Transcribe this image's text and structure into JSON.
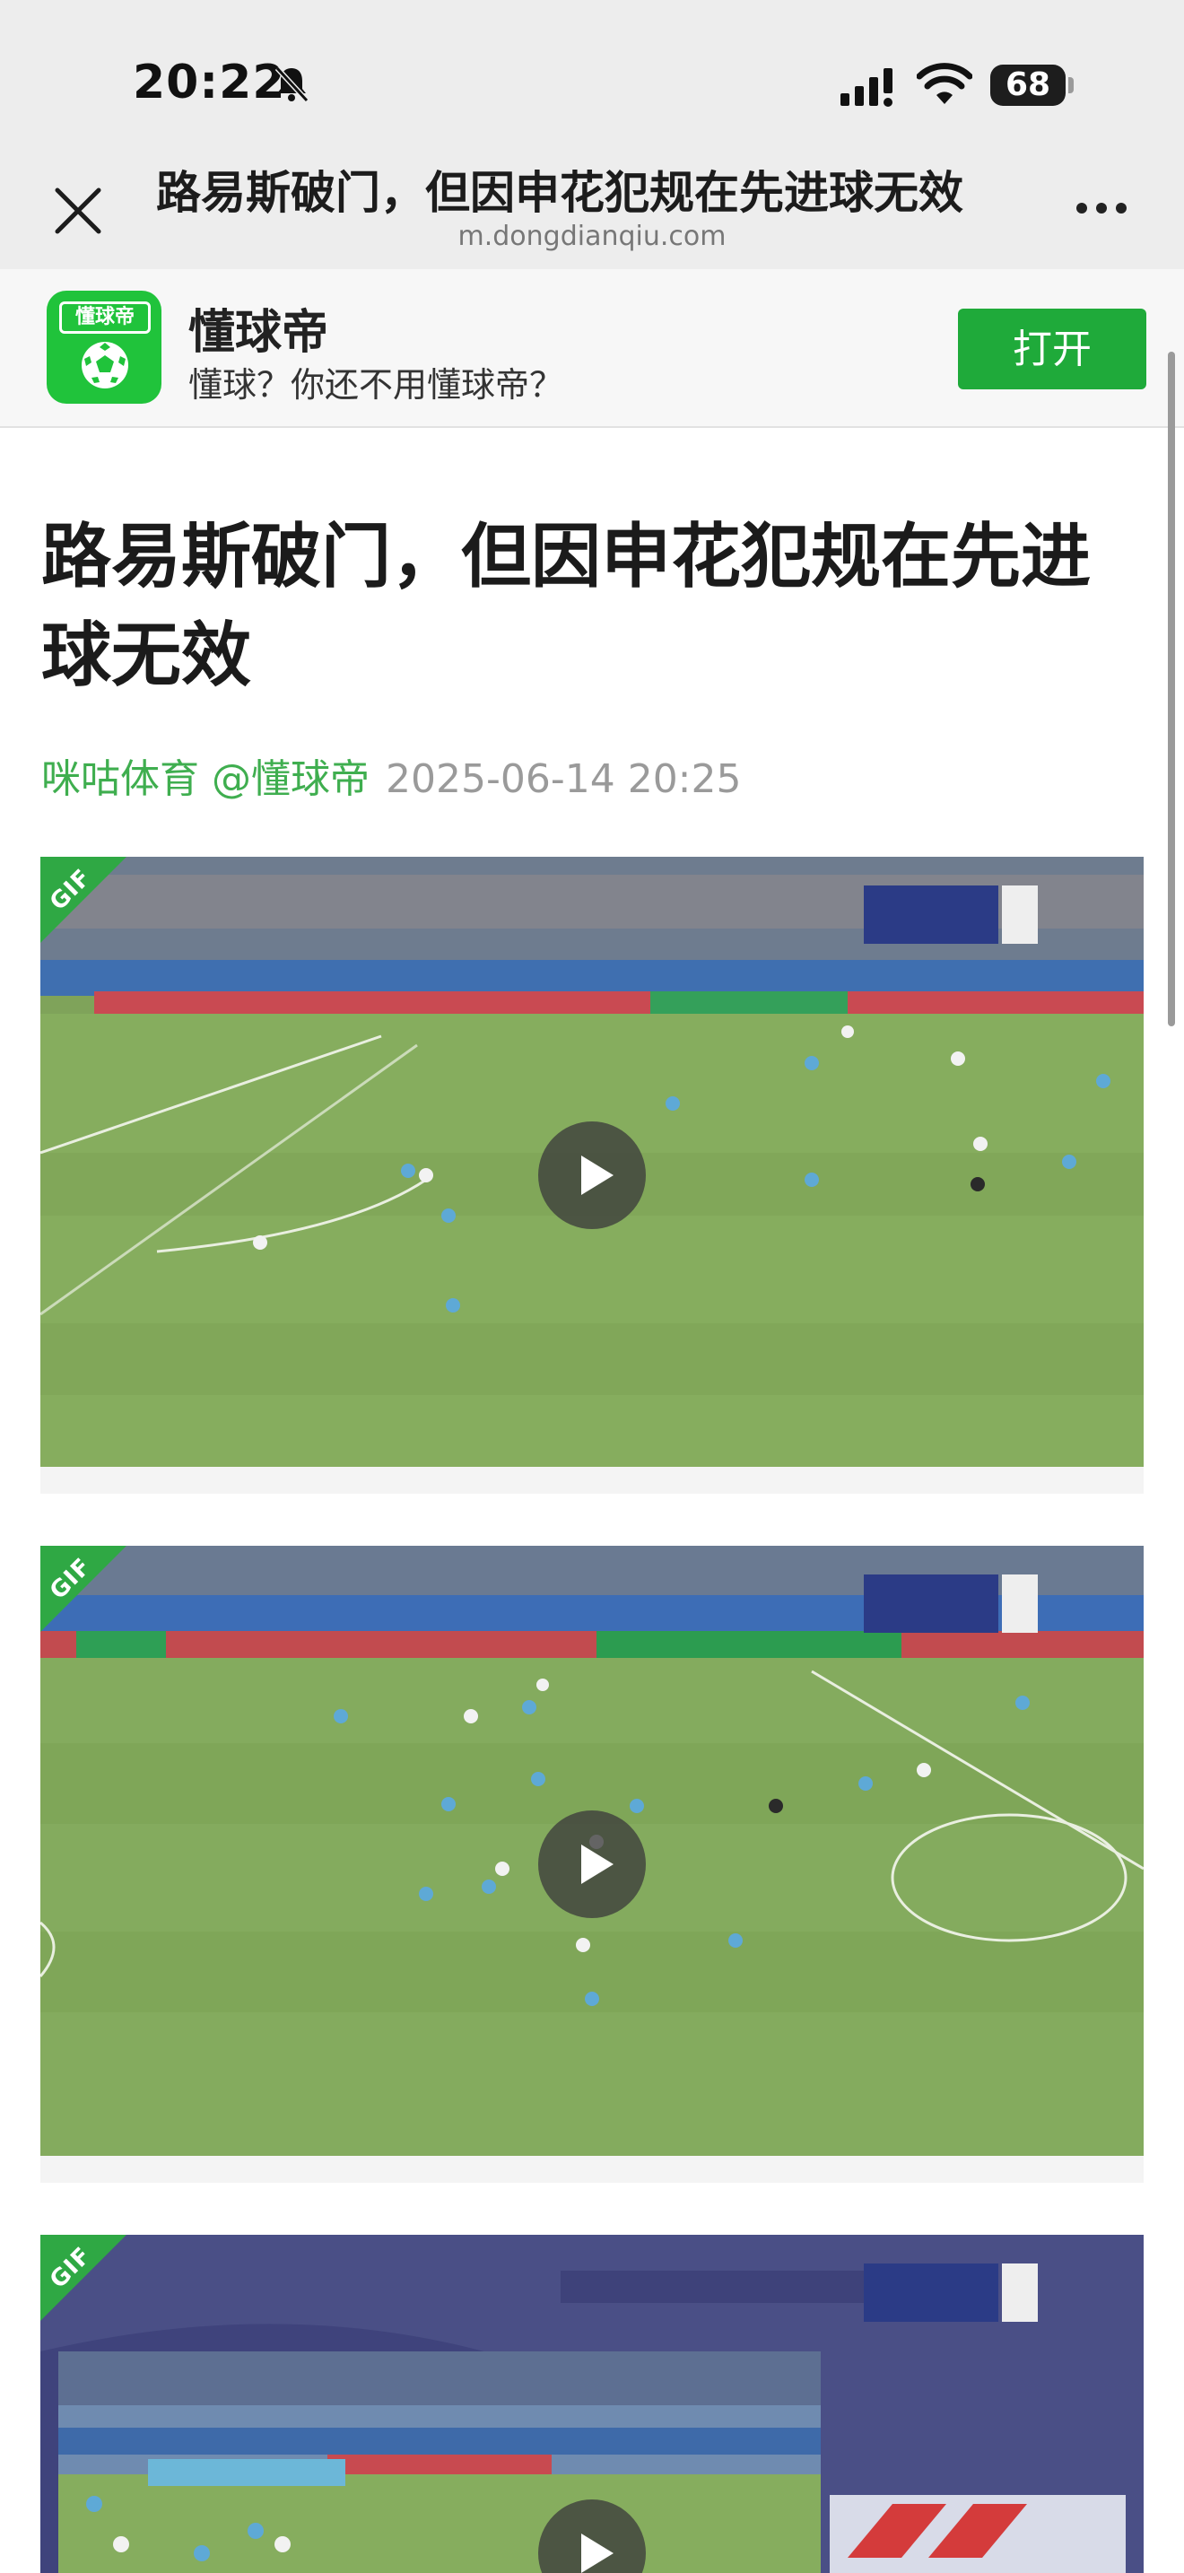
{
  "status_bar": {
    "time": "20:22",
    "battery": "68",
    "icons": [
      "bell-muted-icon",
      "signal-icon",
      "wifi-icon",
      "battery-icon"
    ]
  },
  "browser": {
    "title": "路易斯破门，但因申花犯规在先进球无效",
    "url": "m.dongdianqiu.com",
    "close_icon": "close-icon",
    "more_icon": "more-icon"
  },
  "promo": {
    "logo_text": "懂球帝",
    "app_name": "懂球帝",
    "slogan": "懂球？你还不用懂球帝？",
    "open_label": "打开",
    "accent": "#20c33b"
  },
  "article": {
    "title": "路易斯破门，但因申花犯规在先进球无效",
    "source": "咪咕体育 @懂球帝",
    "date": "2025-06-14 20:25"
  },
  "gifs": [
    {
      "badge": "GIF",
      "kind": "football-broadcast"
    },
    {
      "badge": "GIF",
      "kind": "football-broadcast"
    },
    {
      "badge": "GIF",
      "kind": "replay-broadcast"
    }
  ]
}
